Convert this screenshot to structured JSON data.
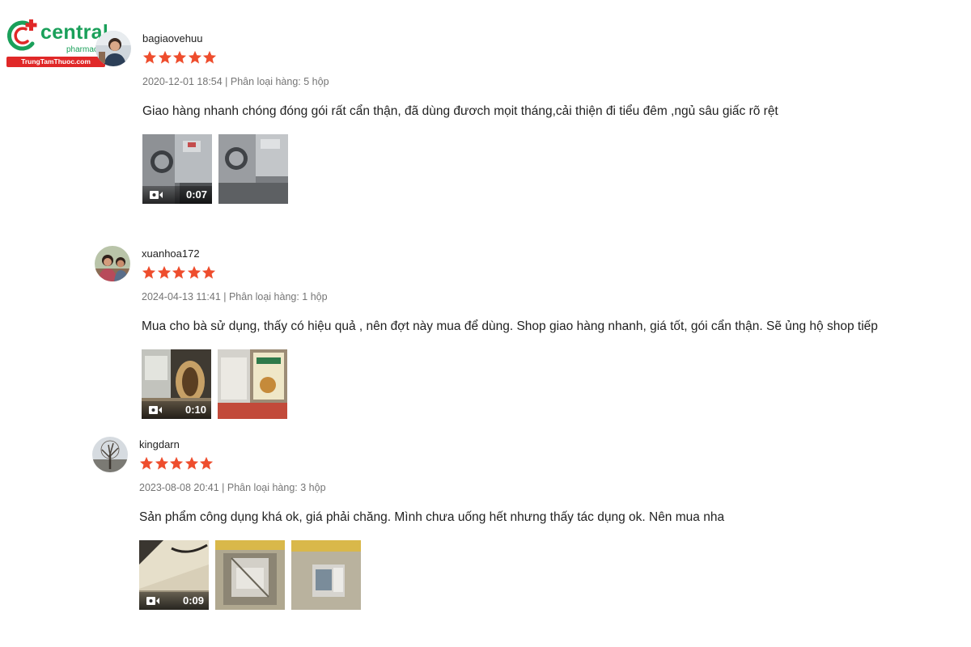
{
  "logo": {
    "brand": "central",
    "sub": "pharmacy",
    "ribbon": "TrungTamThuoc.com",
    "colors": {
      "green": "#1aa05a",
      "red": "#e02828"
    }
  },
  "rating_star_color": "#ee4d2d",
  "reviews": [
    {
      "username": "bagiaovehuu",
      "rating": 5,
      "meta": "2020-12-01 18:54 | Phân loại hàng: 5 hộp",
      "comment": "Giao hàng nhanh chóng đóng gói rất cẩn thận, đã dùng đươch mọit tháng,cải thiện đi tiểu đêm ,ngủ sâu giấc rõ rệt",
      "media": [
        {
          "type": "video",
          "duration": "0:07"
        },
        {
          "type": "image"
        }
      ]
    },
    {
      "username": "xuanhoa172",
      "rating": 5,
      "meta": "2024-04-13 11:41 | Phân loại hàng: 1 hộp",
      "comment": "Mua cho bà sử dụng, thấy có hiệu quả , nên đợt này mua để dùng. Shop giao hàng nhanh, giá tốt, gói cẩn thận. Sẽ ủng hộ shop tiếp",
      "media": [
        {
          "type": "video",
          "duration": "0:10"
        },
        {
          "type": "image"
        }
      ]
    },
    {
      "username": "kingdarn",
      "rating": 5,
      "meta": "2023-08-08 20:41 | Phân loại hàng: 3 hộp",
      "comment": "Sản phẩm công dụng khá ok, giá phải chăng. Mình chưa uống hết nhưng thấy tác dụng ok. Nên mua nha",
      "media": [
        {
          "type": "video",
          "duration": "0:09"
        },
        {
          "type": "image"
        },
        {
          "type": "image"
        }
      ]
    }
  ]
}
